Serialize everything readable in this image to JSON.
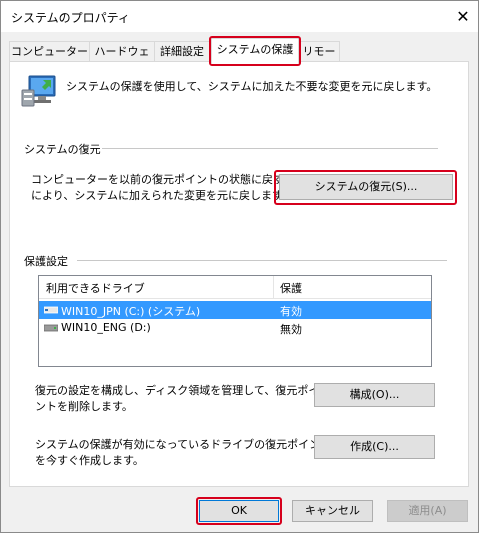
{
  "window": {
    "title": "システムのプロパティ",
    "close_glyph": "✕"
  },
  "tabs": [
    {
      "label": "コンピューター名"
    },
    {
      "label": "ハードウェア"
    },
    {
      "label": "詳細設定"
    },
    {
      "label": "システムの保護"
    },
    {
      "label": "リモート"
    }
  ],
  "intro_text": "システムの保護を使用して、システムに加えた不要な変更を元に戻します。",
  "restore": {
    "heading": "システムの復元",
    "desc_line1": "コンピューターを以前の復元ポイントの状態に戻すこと",
    "desc_line2": "により、システムに加えられた変更を元に戻します。",
    "button_label": "システムの復元(S)..."
  },
  "protection": {
    "heading": "保護設定",
    "columns": [
      "利用できるドライブ",
      "保護"
    ],
    "drives": [
      {
        "name": "WIN10_JPN (C:) (システム)",
        "status": "有効",
        "selected": true
      },
      {
        "name": "WIN10_ENG (D:)",
        "status": "無効",
        "selected": false
      }
    ],
    "configure_desc_line1": "復元の設定を構成し、ディスク領域を管理して、復元ポイ",
    "configure_desc_line2": "ントを削除します。",
    "configure_button": "構成(O)...",
    "create_desc_line1": "システムの保護が有効になっているドライブの復元ポイント",
    "create_desc_line2": "を今すぐ作成します。",
    "create_button": "作成(C)..."
  },
  "footer": {
    "ok": "OK",
    "cancel": "キャンセル",
    "apply": "適用(A)"
  },
  "colors": {
    "highlight": "#d6001c",
    "selection": "#3399ff",
    "focus_border": "#0078d7"
  }
}
